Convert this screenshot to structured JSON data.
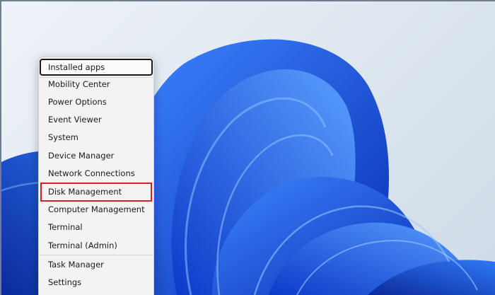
{
  "context_menu": {
    "items": [
      {
        "label": "Installed apps"
      },
      {
        "label": "Mobility Center"
      },
      {
        "label": "Power Options"
      },
      {
        "label": "Event Viewer"
      },
      {
        "label": "System"
      },
      {
        "label": "Device Manager"
      },
      {
        "label": "Network Connections"
      },
      {
        "label": "Disk Management"
      },
      {
        "label": "Computer Management"
      },
      {
        "label": "Terminal"
      },
      {
        "label": "Terminal (Admin)"
      },
      {
        "label": "Task Manager"
      },
      {
        "label": "Settings"
      }
    ],
    "focused_item": "Installed apps",
    "highlighted_item": "Disk Management"
  },
  "colors": {
    "highlight_box": "#d81f26",
    "wallpaper_blue": "#1f5fe0",
    "background": "#dde6ef"
  },
  "icons": [
    "windows-11-bloom-wallpaper"
  ]
}
